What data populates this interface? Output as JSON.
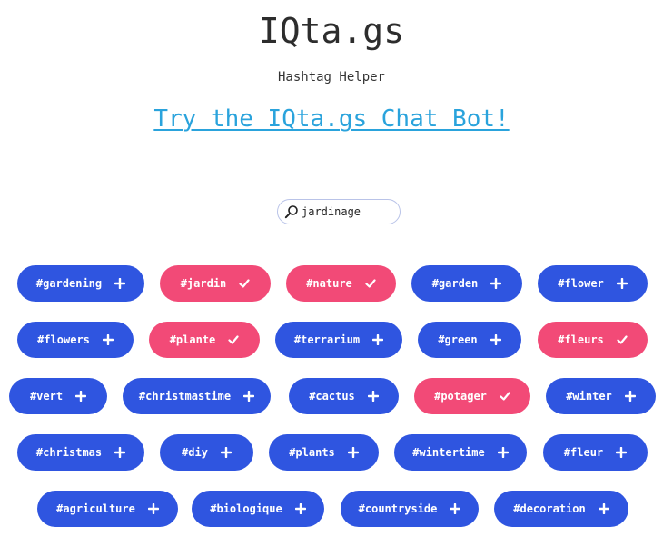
{
  "header": {
    "title": "IQta.gs",
    "subtitle": "Hashtag Helper",
    "chat_link": "Try the IQta.gs Chat Bot!"
  },
  "search": {
    "value": "jardinage",
    "icon": "search-icon"
  },
  "colors": {
    "unselected": "#2f55e0",
    "selected": "#f24a77",
    "link": "#2aa3dc"
  },
  "tags": [
    {
      "label": "#gardening",
      "selected": false
    },
    {
      "label": "#jardin",
      "selected": true
    },
    {
      "label": "#nature",
      "selected": true
    },
    {
      "label": "#garden",
      "selected": false
    },
    {
      "label": "#flower",
      "selected": false
    },
    {
      "label": "#flowers",
      "selected": false
    },
    {
      "label": "#plante",
      "selected": true
    },
    {
      "label": "#terrarium",
      "selected": false
    },
    {
      "label": "#green",
      "selected": false
    },
    {
      "label": "#fleurs",
      "selected": true
    },
    {
      "label": "#vert",
      "selected": false
    },
    {
      "label": "#christmastime",
      "selected": false
    },
    {
      "label": "#cactus",
      "selected": false
    },
    {
      "label": "#potager",
      "selected": true
    },
    {
      "label": "#winter",
      "selected": false
    },
    {
      "label": "#christmas",
      "selected": false
    },
    {
      "label": "#diy",
      "selected": false
    },
    {
      "label": "#plants",
      "selected": false
    },
    {
      "label": "#wintertime",
      "selected": false
    },
    {
      "label": "#fleur",
      "selected": false
    },
    {
      "label": "#agriculture",
      "selected": false
    },
    {
      "label": "#biologique",
      "selected": false
    },
    {
      "label": "#countryside",
      "selected": false
    },
    {
      "label": "#decoration",
      "selected": false
    }
  ]
}
